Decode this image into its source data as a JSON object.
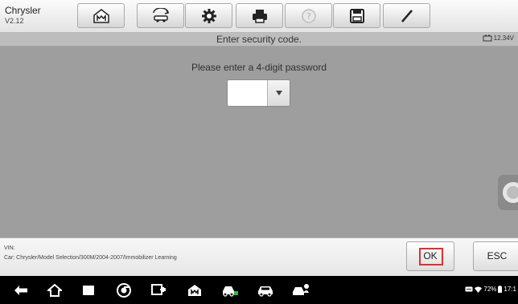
{
  "app": {
    "name": "Chrysler",
    "version": "V2.12"
  },
  "toolbar": {
    "buttons": [
      {
        "name": "home-icon"
      },
      {
        "name": "vehicle-swap-icon"
      },
      {
        "name": "settings-gear-icon"
      },
      {
        "name": "print-icon"
      },
      {
        "name": "help-icon"
      },
      {
        "name": "save-icon"
      },
      {
        "name": "edit-pen-icon"
      }
    ]
  },
  "titlebar": {
    "title": "Enter security code.",
    "battery_voltage": "12.34V"
  },
  "main": {
    "prompt": "Please enter a 4-digit password",
    "password_value": ""
  },
  "info": {
    "vin_label": "VIN:",
    "path": "Car: Chrysler/Model Selection/300M/2004-2007/Immobilizer Learning"
  },
  "actions": {
    "ok_label": "OK",
    "esc_label": "ESC"
  },
  "status": {
    "battery_percent": "72%",
    "time": "17:1"
  },
  "colors": {
    "highlight": "#e03030",
    "background": "#9e9e9e"
  }
}
